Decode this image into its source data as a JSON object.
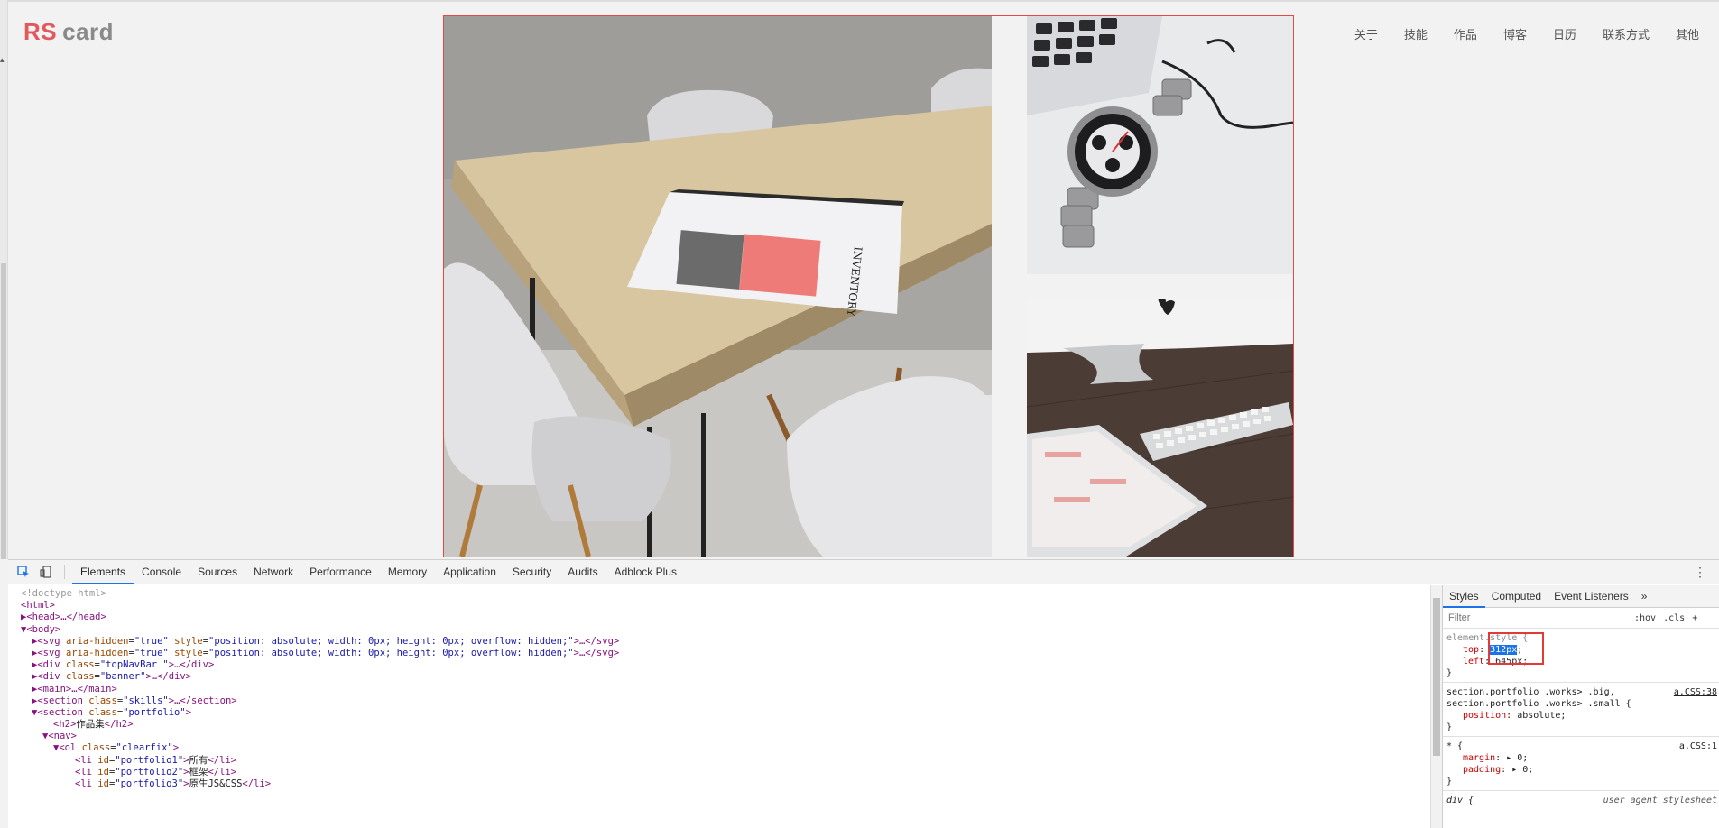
{
  "logo": {
    "strong": "RS",
    "light": "card"
  },
  "nav": [
    "关于",
    "技能",
    "作品",
    "博客",
    "日历",
    "联系方式",
    "其他"
  ],
  "devtools": {
    "tabs": [
      "Elements",
      "Console",
      "Sources",
      "Network",
      "Performance",
      "Memory",
      "Application",
      "Security",
      "Audits",
      "Adblock Plus"
    ],
    "active_tab": "Elements",
    "dom": {
      "l1": "<!doctype html>",
      "l2_tag": "<html>",
      "l3": "<head>…</head>",
      "l4": "<body>",
      "svg_a": "svg aria-hidden",
      "svg_v": "true",
      "svg_style": "style",
      "svg_style_v": "position: absolute; width: 0px; height: 0px; overflow: hidden;",
      "topnav_class": "topNavBar ",
      "banner_class": "banner",
      "main": "<main>…</main>",
      "skills_class": "skills",
      "portfolio_class": "portfolio",
      "h2_text": "作品集",
      "nav": "<nav>",
      "ol_class": "clearfix",
      "li1_id": "portfolio1",
      "li1_text": "所有",
      "li2_id": "portfolio2",
      "li2_text": "框架",
      "li3_id": "portfolio3",
      "li3_text": "原生JS&CSS"
    },
    "styles": {
      "tabs": [
        "Styles",
        "Computed",
        "Event Listeners",
        "»"
      ],
      "filter_placeholder": "Filter",
      "hov": ":hov",
      "cls": ".cls",
      "plus": "+",
      "element_style_selector": "element.style {",
      "top_name": "top",
      "top_value": "312px",
      "left_name": "left",
      "left_value": "645px",
      "rule2_selector_a": "section.portfolio .works> .big,",
      "rule2_selector_b": "section.portfolio .works> .small {",
      "rule2_src": "a.CSS:38",
      "rule2_prop": "position",
      "rule2_val": "absolute",
      "rule3_selector": "* {",
      "rule3_src": "a.CSS:1",
      "rule3_p1": "margin",
      "rule3_v1": "0",
      "rule3_p2": "padding",
      "rule3_v2": "0",
      "rule4_selector": "div {",
      "rule4_src": "user agent stylesheet"
    }
  }
}
